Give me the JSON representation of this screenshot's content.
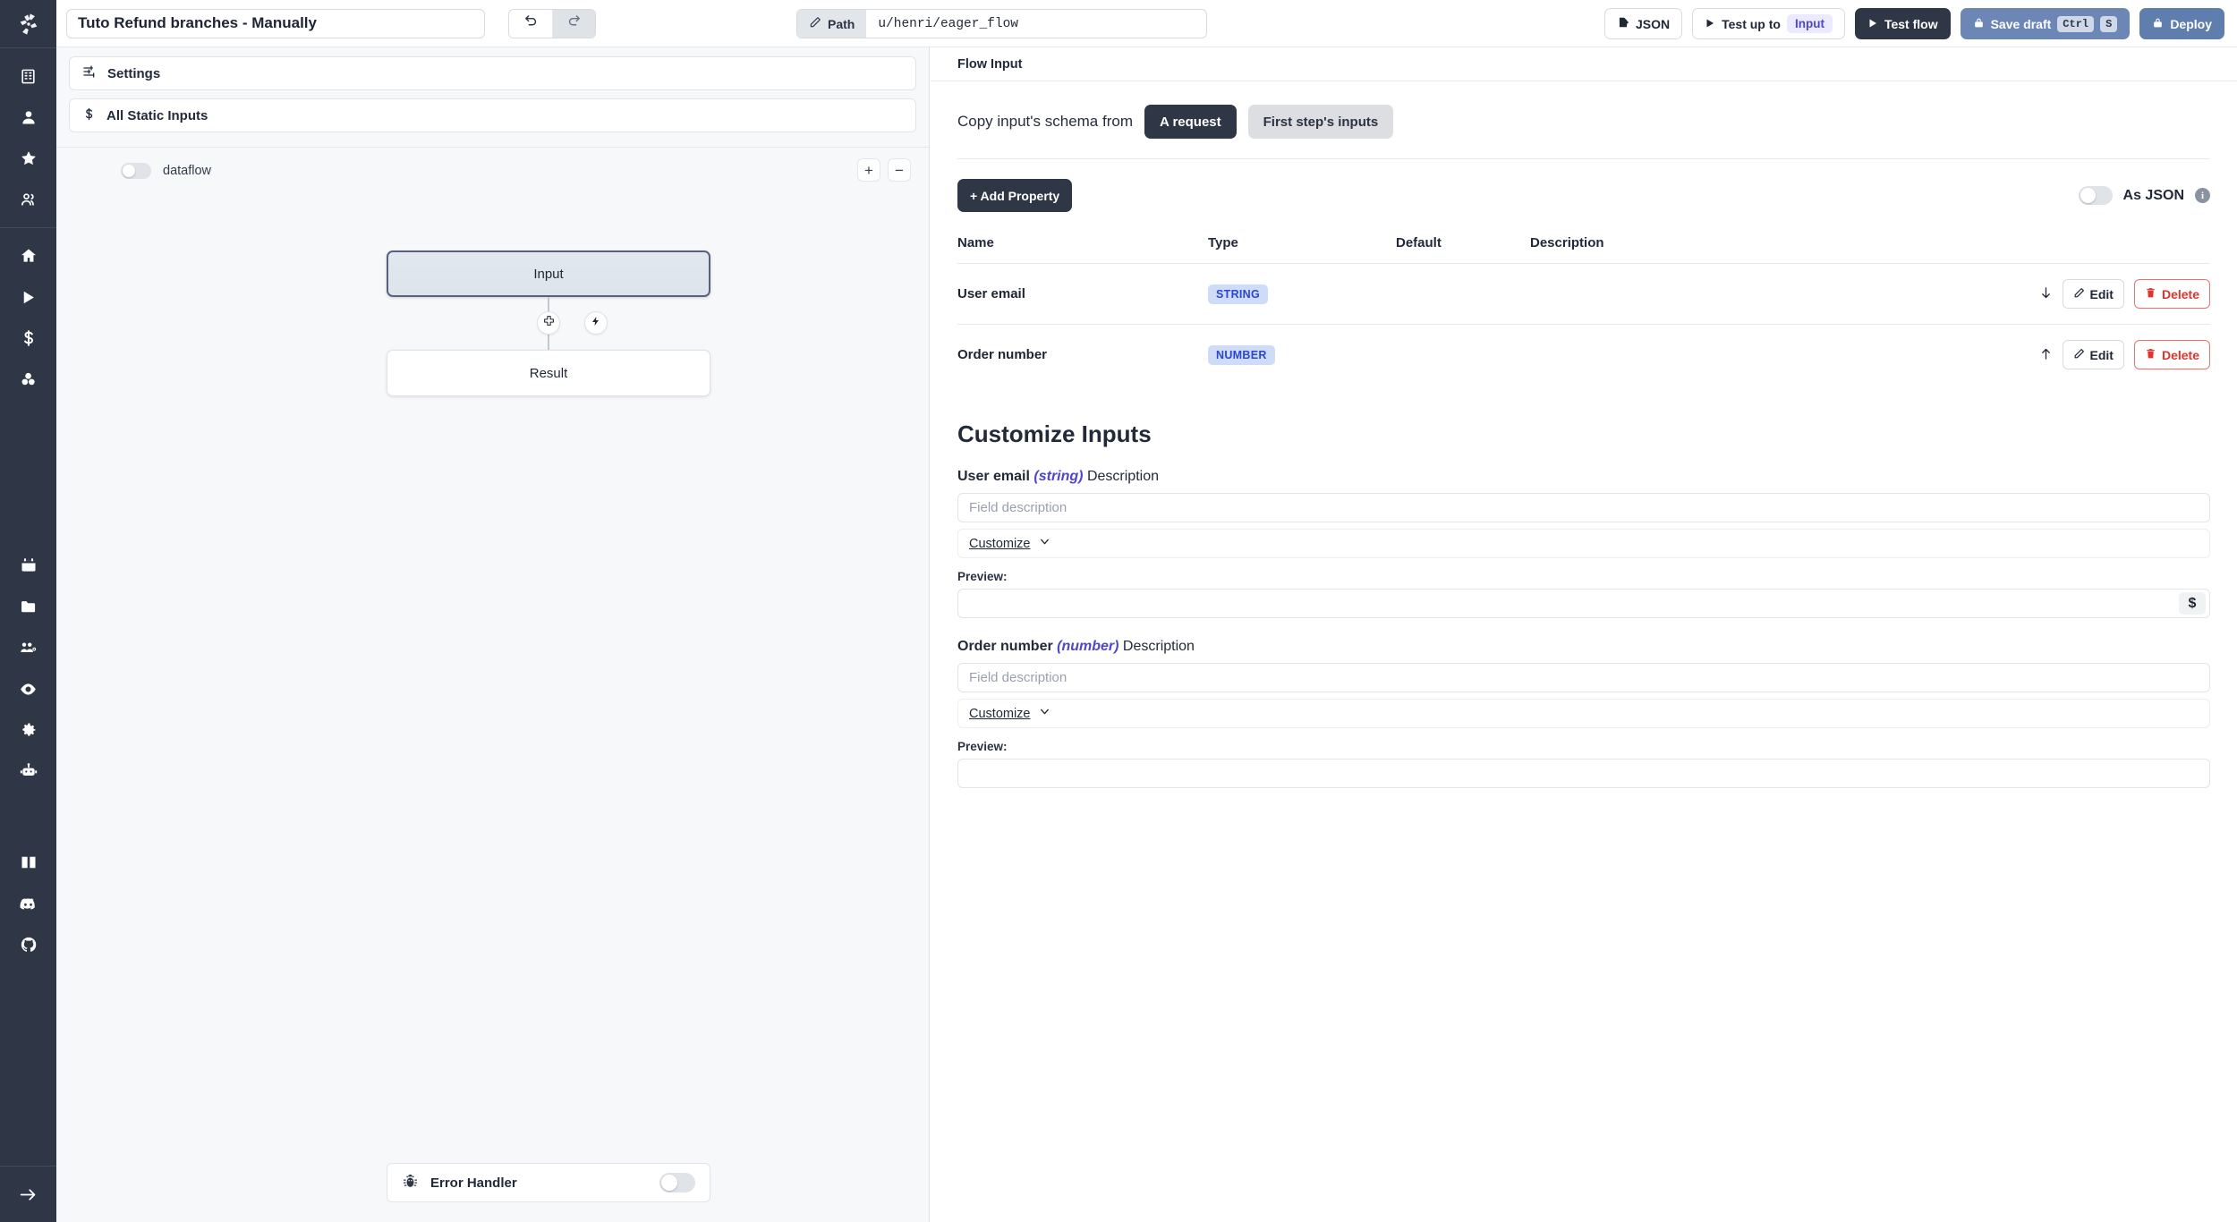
{
  "app": {
    "logo_icon": "windmill-logo-icon"
  },
  "topbar": {
    "flow_title": "Tuto Refund branches - Manually",
    "undo_icon": "undo-icon",
    "redo_icon": "redo-icon",
    "path_label": "Path",
    "path_icon": "pencil-icon",
    "path_value": "u/henri/eager_flow",
    "json_label": "JSON",
    "json_icon": "json-icon",
    "test_up_to_label": "Test up to",
    "test_up_to_target": "Input",
    "test_flow_label": "Test flow",
    "save_draft_label": "Save draft",
    "save_draft_kbd_1": "Ctrl",
    "save_draft_kbd_2": "S",
    "deploy_label": "Deploy",
    "play_icon": "play-icon",
    "lock_icon": "lock-icon"
  },
  "sidebar": {
    "items": [
      {
        "icon": "building-icon",
        "name": "workspace"
      },
      {
        "icon": "user-icon",
        "name": "account"
      },
      {
        "icon": "star-icon",
        "name": "favorites"
      },
      {
        "icon": "users-icon",
        "name": "groups"
      },
      {
        "icon": "home-icon",
        "name": "home"
      },
      {
        "icon": "play-icon",
        "name": "runs"
      },
      {
        "icon": "dollar-icon",
        "name": "variables"
      },
      {
        "icon": "resources-icon",
        "name": "resources"
      },
      {
        "icon": "calendar-icon",
        "name": "schedules"
      },
      {
        "icon": "folder-icon",
        "name": "folders"
      },
      {
        "icon": "workers-icon",
        "name": "workers"
      },
      {
        "icon": "eye-icon",
        "name": "audit-logs"
      },
      {
        "icon": "gear-icon",
        "name": "settings"
      },
      {
        "icon": "robot-icon",
        "name": "ai"
      },
      {
        "icon": "book-icon",
        "name": "docs"
      },
      {
        "icon": "discord-icon",
        "name": "discord"
      },
      {
        "icon": "github-icon",
        "name": "github"
      },
      {
        "icon": "arrow-right-icon",
        "name": "expand-sidebar"
      }
    ]
  },
  "flow_panel": {
    "settings_label": "Settings",
    "settings_icon": "sliders-icon",
    "static_inputs_label": "All Static Inputs",
    "static_inputs_icon": "dollar-icon",
    "dataflow_label": "dataflow",
    "zoom_in_label": "+",
    "zoom_out_label": "−",
    "nodes": [
      {
        "label": "Input",
        "name": "flow-node-input",
        "selected": true
      },
      {
        "label": "Result",
        "name": "flow-node-result",
        "selected": false
      }
    ],
    "edge_plus_icon": "plus-node-icon",
    "edge_bolt_icon": "bolt-icon",
    "error_handler_label": "Error Handler",
    "error_handler_icon": "bug-icon",
    "error_handler_enabled": false
  },
  "right_panel": {
    "header_title": "Flow Input",
    "copy_schema_label": "Copy input's schema from",
    "copy_options": [
      {
        "label": "A request",
        "selected": true
      },
      {
        "label": "First step's inputs",
        "selected": false
      }
    ],
    "add_property_label": "+ Add Property",
    "as_json_label": "As JSON",
    "as_json_enabled": false,
    "info_icon": "info-icon",
    "table": {
      "headers": [
        "Name",
        "Type",
        "Default",
        "Description"
      ],
      "rows": [
        {
          "name": "User email",
          "type": "STRING",
          "default": "",
          "description": "",
          "move_icon": "arrow-down-icon",
          "edit_label": "Edit",
          "delete_label": "Delete"
        },
        {
          "name": "Order number",
          "type": "NUMBER",
          "default": "",
          "description": "",
          "move_icon": "arrow-up-icon",
          "edit_label": "Edit",
          "delete_label": "Delete"
        }
      ]
    },
    "customize_title": "Customize Inputs",
    "fields": [
      {
        "name": "User email",
        "type": "(string)",
        "suffix": "Description",
        "description_value": "",
        "description_placeholder": "Field description",
        "customize_label": "Customize",
        "chevron_icon": "chevron-down-icon",
        "preview_label": "Preview:",
        "preview_value": "",
        "preview_affix": "$"
      },
      {
        "name": "Order number",
        "type": "(number)",
        "suffix": "Description",
        "description_value": "",
        "description_placeholder": "Field description",
        "customize_label": "Customize",
        "chevron_icon": "chevron-down-icon",
        "preview_label": "Preview:",
        "preview_value": "",
        "preview_affix": ""
      }
    ]
  },
  "colors": {
    "rail_bg": "#2f3747",
    "accent_dark": "#2f3747",
    "accent_blue": "#6c87b5",
    "chip_bg": "#cfdcf8",
    "chip_text": "#2b46cf",
    "danger": "#e0342b",
    "panel_bg": "#f7f8fa"
  }
}
